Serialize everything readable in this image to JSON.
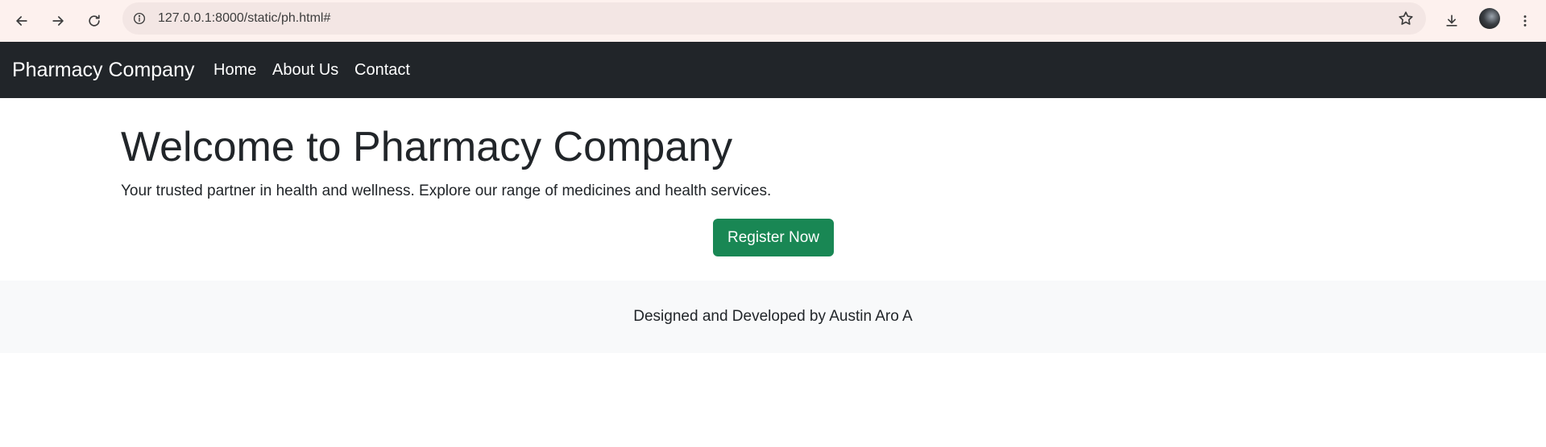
{
  "browser": {
    "url": "127.0.0.1:8000/static/ph.html#",
    "icons": [
      "back-arrow-icon",
      "forward-arrow-icon",
      "reload-icon",
      "info-icon",
      "bookmark-star-icon",
      "download-icon",
      "profile-avatar",
      "more-vert-icon"
    ]
  },
  "navbar": {
    "brand": "Pharmacy Company",
    "links": [
      "Home",
      "About Us",
      "Contact"
    ],
    "background": "#212529"
  },
  "hero": {
    "title": "Welcome to Pharmacy Company",
    "lead": "Your trusted partner in health and wellness. Explore our range of medicines and health services.",
    "button_label": "Register Now",
    "button_color": "#198754"
  },
  "footer": {
    "text": "Designed and Developed by Austin Aro A",
    "background": "#f8f9fa"
  }
}
